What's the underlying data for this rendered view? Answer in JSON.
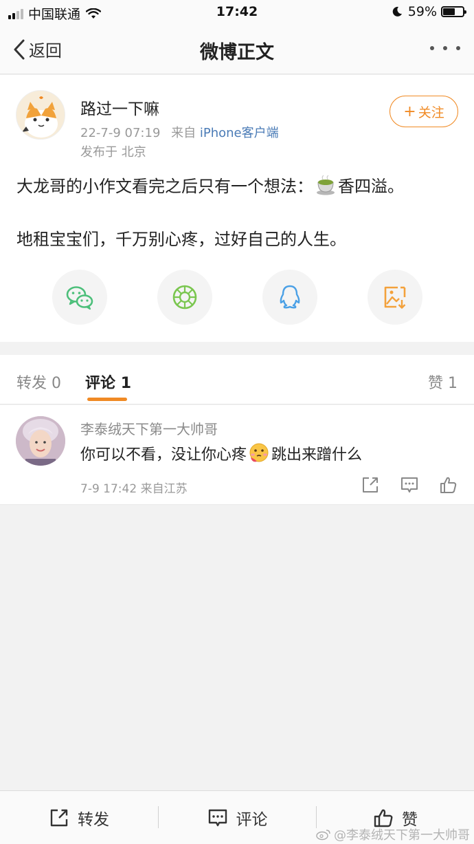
{
  "status_bar": {
    "carrier": "中国联通",
    "time": "17:42",
    "battery": "59%",
    "battery_level": 0.59
  },
  "nav": {
    "back_label": "返回",
    "title": "微博正文"
  },
  "post": {
    "author": "路过一下嘛",
    "date": "22-7-9 07:19",
    "source_prefix": "来自",
    "source": "iPhone客户端",
    "location": "发布于 北京",
    "follow_label": "关注",
    "line1_before": "大龙哥的小作文看完之后只有一个想法：",
    "line1_after": "香四溢。",
    "line2": "地租宝宝们，千万别心疼，过好自己的人生。",
    "share_icons": [
      "wechat-icon",
      "moments-icon",
      "qq-icon",
      "save-image-icon"
    ],
    "colors": {
      "accent": "#f08a24",
      "link": "#4a7bb6"
    }
  },
  "tabs": {
    "repost": "转发 0",
    "comments_label": "评论",
    "comments_count": "1",
    "likes": "赞 1"
  },
  "comment": {
    "user": "李泰绒天下第一大帅哥",
    "text_before": "你可以不看，没让你心疼",
    "text_after": "跳出来蹭什么",
    "meta": "7-9 17:42  来自江苏"
  },
  "bottom_bar": {
    "repost": "转发",
    "comment": "评论",
    "like": "赞"
  },
  "watermark": "@李泰绒天下第一大帅哥"
}
